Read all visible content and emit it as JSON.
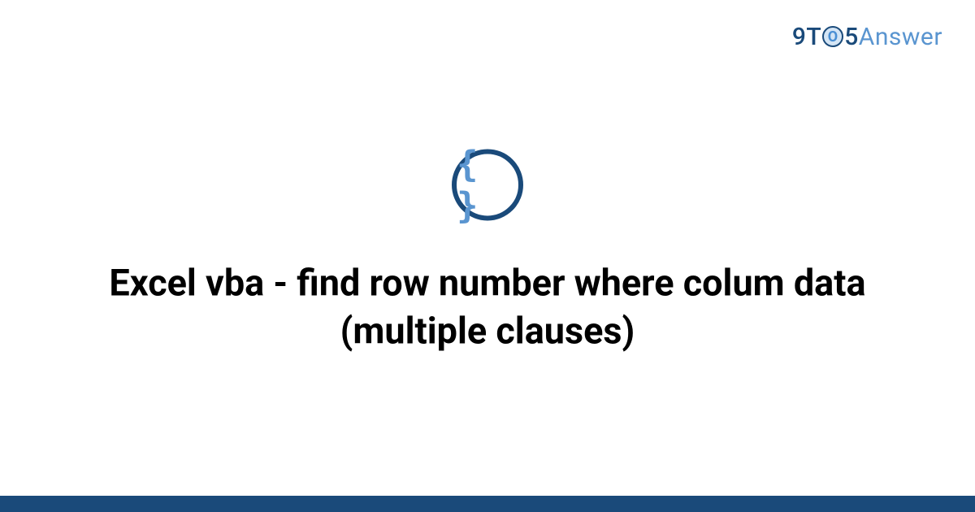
{
  "brand": {
    "nine": "9",
    "t": "T",
    "clock_inner": "O",
    "five": "5",
    "answer": "Answer"
  },
  "icon": {
    "glyph": "{ }"
  },
  "main": {
    "title": "Excel vba - find row number where colum data (multiple clauses)"
  }
}
